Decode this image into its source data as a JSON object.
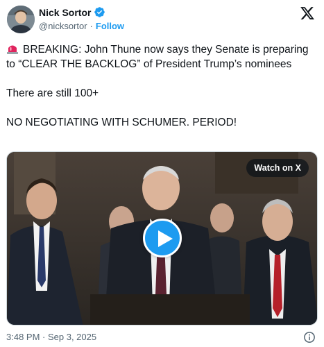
{
  "author": {
    "display_name": "Nick Sortor",
    "handle": "@nicksortor",
    "separator": "·",
    "follow_label": "Follow",
    "verified": true,
    "verified_color": "#1d9bf0"
  },
  "tweet": {
    "line1": "BREAKING: John Thune now says they Senate is preparing to “CLEAR THE BACKLOG” of President Trump’s nominees",
    "line2": "There are still 100+",
    "line3": "NO NEGOTIATING WITH SCHUMER. PERIOD!",
    "lead_emoji": "siren-icon"
  },
  "media": {
    "watch_label": "Watch on X",
    "play_icon": "play-icon"
  },
  "footer": {
    "timestamp": "3:48 PM · Sep 3, 2025",
    "info_icon": "info-icon"
  },
  "colors": {
    "accent": "#1d9bf0",
    "text": "#0f1419",
    "secondary": "#536471"
  }
}
